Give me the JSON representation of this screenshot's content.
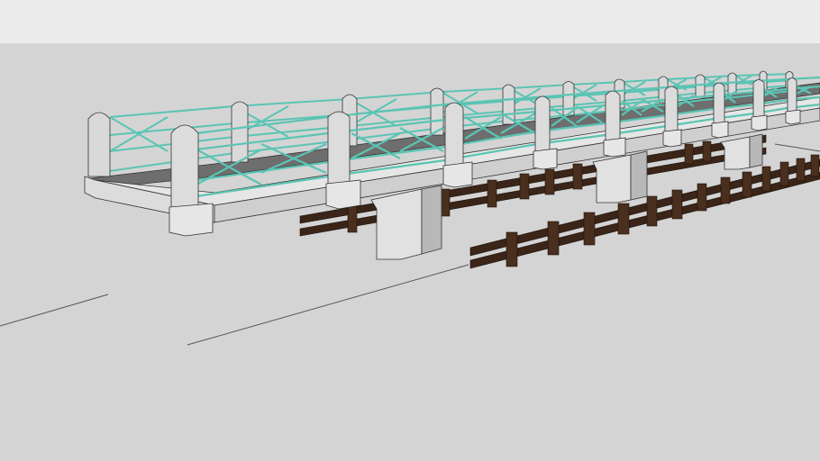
{
  "viewport": {
    "sky_color": "#ececec",
    "ground_color": "#d4d4d4"
  },
  "model": {
    "railing_color": "#5bc4b4",
    "concrete_color": "#d9d9d9",
    "deck_color": "#6e6e6e",
    "wood_color": "#3a2518"
  }
}
